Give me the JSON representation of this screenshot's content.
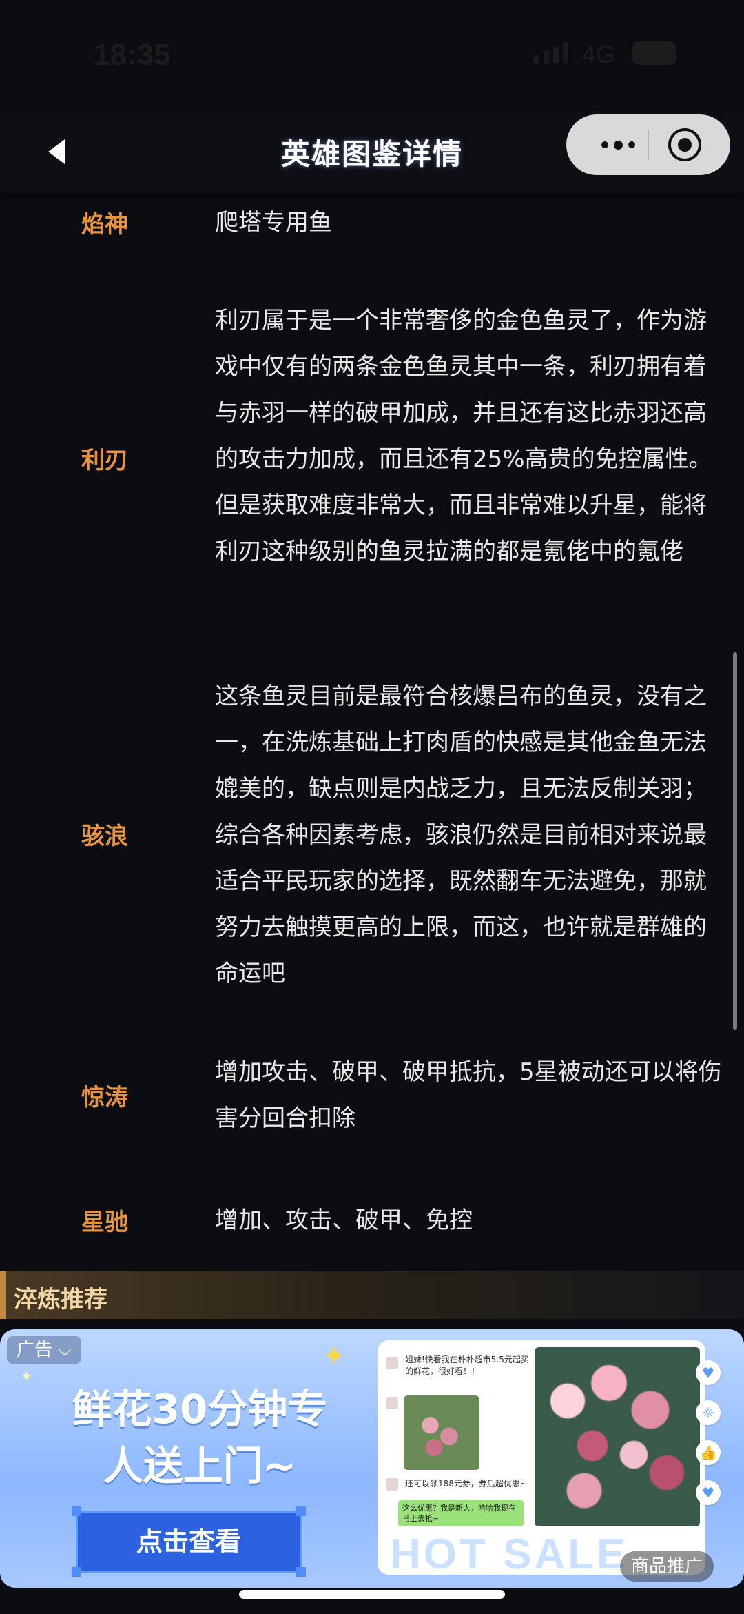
{
  "status_bar": {
    "time": "18:35",
    "network": "4G"
  },
  "nav": {
    "title": "英雄图鉴详情"
  },
  "rows": [
    {
      "name": "焰神",
      "desc": "爬塔专用鱼"
    },
    {
      "name": "利刃",
      "desc": "利刃属于是一个非常奢侈的金色鱼灵了，作为游戏中仅有的两条金色鱼灵其中一条，利刃拥有着与赤羽一样的破甲加成，并且还有这比赤羽还高的攻击力加成，而且还有25%高贵的免控属性。但是获取难度非常大，而且非常难以升星，能将利刃这种级别的鱼灵拉满的都是氪佬中的氪佬"
    },
    {
      "name": "骇浪",
      "desc": "这条鱼灵目前是最符合核爆吕布的鱼灵，没有之一，在洗炼基础上打肉盾的快感是其他金鱼无法媲美的，缺点则是内战乏力，且无法反制关羽；综合各种因素考虑，骇浪仍然是目前相对来说最适合平民玩家的选择，既然翻车无法避免，那就努力去触摸更高的上限，而这，也许就是群雄的命运吧"
    },
    {
      "name": "惊涛",
      "desc": "增加攻击、破甲、破甲抵抗，5星被动还可以将伤害分回合扣除"
    },
    {
      "name": "星驰",
      "desc": "增加、攻击、破甲、免控"
    }
  ],
  "section": {
    "title": "淬炼推荐"
  },
  "ad": {
    "tag": "广告 ⌵",
    "headline_line1": "鲜花30分钟专",
    "headline_line2": "人送上门~",
    "button_label": "点击查看",
    "chat_line1": "姐妹!快看我在朴朴超市5.5元起买的鲜花，很好看！！",
    "chat_line2": "还可以领188元券，券后超优惠~",
    "chat_green": "这么优惠？我是新人，哈哈我现在马上去抢~",
    "hot_sale": "HOT SALE",
    "promo": "商品推广"
  }
}
